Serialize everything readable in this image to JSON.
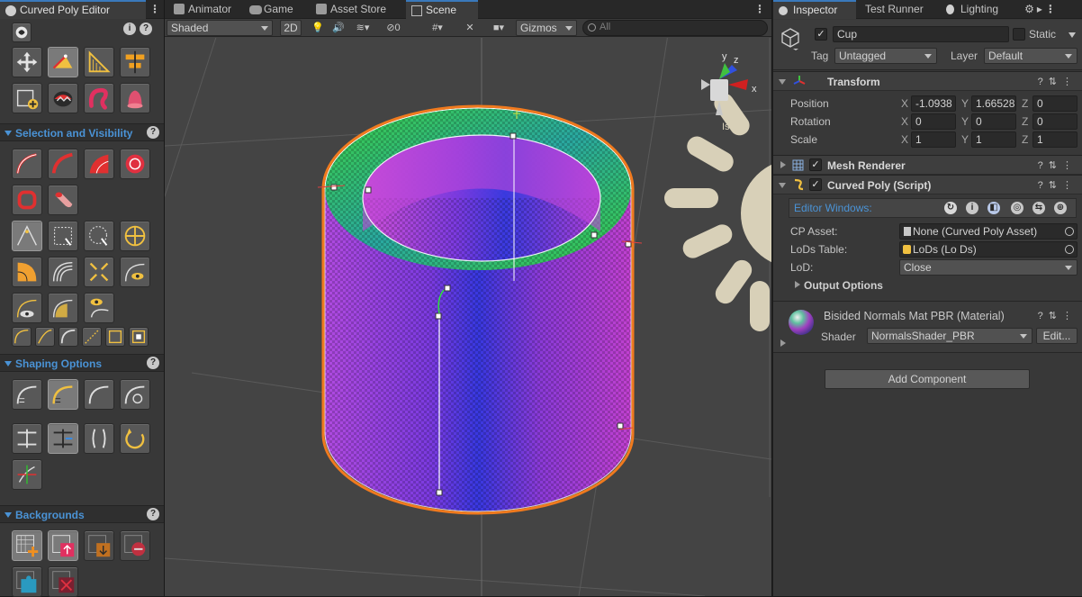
{
  "left_panel": {
    "tab_title": "Curved Poly Editor",
    "sections": [
      {
        "title": "Selection and Visibility"
      },
      {
        "title": "Shaping Options"
      },
      {
        "title": "Backgrounds"
      }
    ]
  },
  "scene_tabs": [
    {
      "label": "Animator",
      "icon": "animator-icon"
    },
    {
      "label": "Game",
      "icon": "game-icon"
    },
    {
      "label": "Asset Store",
      "icon": "asset-store-icon"
    },
    {
      "label": "Scene",
      "icon": "scene-grid-icon"
    }
  ],
  "scene_toolbar": {
    "shading_mode": "Shaded",
    "toggle_2d": "2D",
    "hidden_count": "0",
    "gizmos": "Gizmos",
    "search_placeholder": "All"
  },
  "gizmo": {
    "axis_y": "y",
    "axis_z": "z",
    "axis_x": "x",
    "view_label": "Iso"
  },
  "inspector_tabs": [
    {
      "label": "Inspector",
      "icon": "info-icon"
    },
    {
      "label": "Test Runner",
      "icon": ""
    },
    {
      "label": "Lighting",
      "icon": "lightbulb-icon"
    }
  ],
  "object": {
    "name": "Cup",
    "static_label": "Static",
    "tag_label": "Tag",
    "tag_value": "Untagged",
    "layer_label": "Layer",
    "layer_value": "Default"
  },
  "transform": {
    "title": "Transform",
    "position_label": "Position",
    "rotation_label": "Rotation",
    "scale_label": "Scale",
    "position": {
      "x": "-1.0938",
      "y": "1.66528",
      "z": "0"
    },
    "rotation": {
      "x": "0",
      "y": "0",
      "z": "0"
    },
    "scale": {
      "x": "1",
      "y": "1",
      "z": "1"
    },
    "axis_x": "X",
    "axis_y": "Y",
    "axis_z": "Z"
  },
  "mesh_renderer": {
    "title": "Mesh Renderer"
  },
  "curved_poly": {
    "title": "Curved Poly (Script)",
    "editor_windows_label": "Editor Windows:",
    "cp_asset_label": "CP Asset:",
    "cp_asset_value": "None (Curved Poly Asset)",
    "lods_label": "LoDs Table:",
    "lods_value": "LoDs (Lo Ds)",
    "lod_label": "LoD:",
    "lod_value": "Close",
    "output_options": "Output Options"
  },
  "material": {
    "title": "Bisided Normals Mat PBR (Material)",
    "shader_label": "Shader",
    "shader_value": "NormalsShader_PBR",
    "edit_label": "Edit..."
  },
  "add_component_label": "Add Component",
  "colors": {
    "accent_blue": "#3a79bb",
    "section_blue": "#4a93d6",
    "outline_orange": "#f07a1e",
    "mesh_purple": "#a03ad8",
    "mesh_blue": "#3a3ae0"
  }
}
